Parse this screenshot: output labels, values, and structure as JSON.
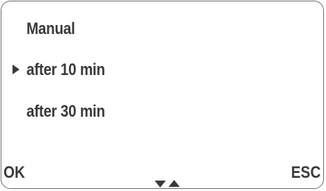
{
  "menu": {
    "items": [
      {
        "label": "Manual",
        "selected": false
      },
      {
        "label": "after 10 min",
        "selected": true
      },
      {
        "label": "after 30 min",
        "selected": false
      }
    ]
  },
  "softkeys": {
    "left_label": "OK",
    "right_label": "ESC"
  },
  "icons": {
    "cursor": "selection-arrow-icon",
    "scroll": [
      "scroll-down-icon",
      "scroll-up-icon"
    ]
  },
  "colors": {
    "text": "#3a3a3a",
    "border": "#6b6b6b",
    "background": "#ffffff"
  }
}
